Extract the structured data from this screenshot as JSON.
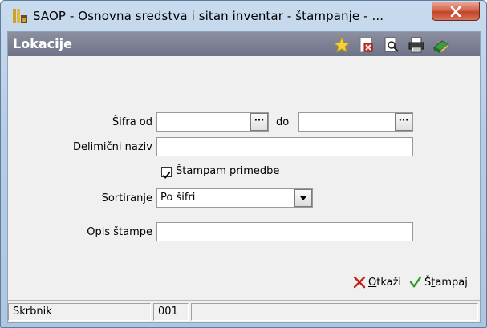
{
  "window": {
    "title": "SAOP - Osnovna sredstva i sitan inventar - štampanje - ...",
    "close_label": "×"
  },
  "header": {
    "title": "Lokacije",
    "icons": [
      "star-icon",
      "delete-report-icon",
      "print-preview-icon",
      "printer-icon",
      "book-icon"
    ]
  },
  "form": {
    "sifra_od_label": "Šifra od",
    "sifra_od_value": "",
    "do_label": "do",
    "sifra_do_value": "",
    "dots_label": "···",
    "delimicni_naziv_label": "Delimični naziv",
    "delimicni_naziv_value": "",
    "stampam_primedbe_label": "Štampam primedbe",
    "stampam_primedbe_checked": true,
    "sortiranje_label": "Sortiranje",
    "sortiranje_value": "Po šifri",
    "opis_stampe_label": "Opis štampe",
    "opis_stampe_value": ""
  },
  "footer": {
    "cancel_label_underlined": "O",
    "cancel_label_rest": "tkaži",
    "print_label_first": "Š",
    "print_label_underlined": "t",
    "print_label_rest": "ampaj"
  },
  "statusbar": {
    "label": "Skrbnik",
    "value": "001",
    "extra": ""
  },
  "colors": {
    "header_bg": "#7a7d92",
    "window_frame": "#b9cfe7",
    "close_red": "#c9452b",
    "cancel_red": "#c0201a",
    "print_green": "#2e9a2e"
  }
}
